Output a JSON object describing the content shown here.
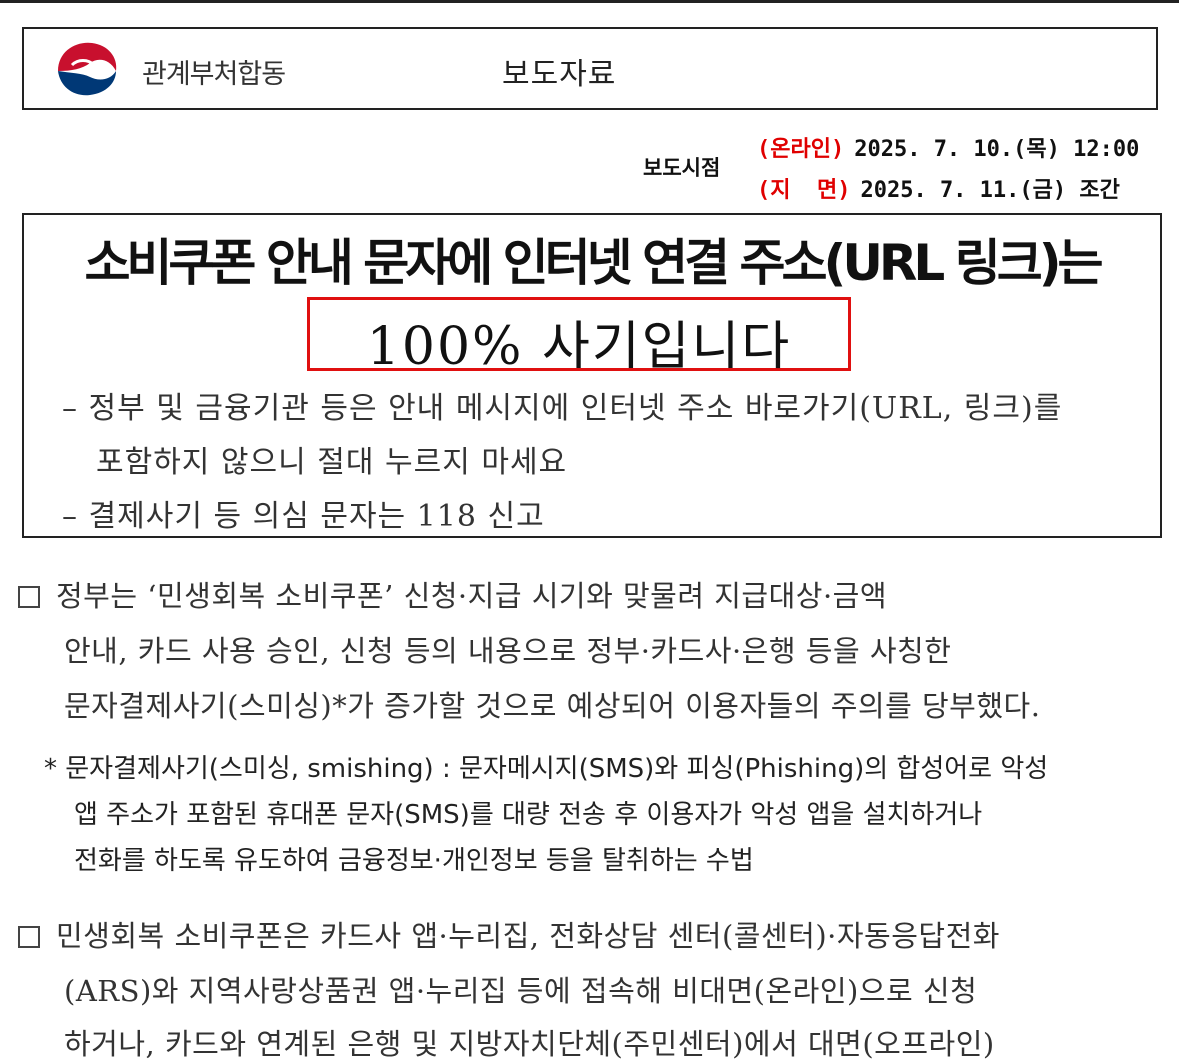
{
  "header": {
    "department": "관계부처합동",
    "doc_type": "보도자료",
    "emblem_icon": "taegeuk-emblem-icon"
  },
  "release": {
    "label": "보도시점",
    "online_kind": "(온라인)",
    "online_date": "2025. 7. 10.(목) 12:00",
    "print_kind": "(지  면)",
    "print_date": "2025. 7. 11.(금) 조간"
  },
  "headline": {
    "line1": "소비쿠폰 안내 문자에 인터넷 연결 주소(URL 링크)는",
    "line2": "100% 사기입니다",
    "sub1a": "– 정부 및 금융기관 등은 안내 메시지에 인터넷 주소 바로가기(URL, 링크)를",
    "sub1b": "포함하지 않으니 절대 누르지 마세요",
    "sub2": "– 결제사기 등 의심 문자는 118 신고"
  },
  "body": {
    "p1": [
      "정부는 ‘민생회복 소비쿠폰’ 신청·지급 시기와 맞물려 지급대상·금액",
      "안내, 카드 사용 승인, 신청 등의 내용으로 정부·카드사·은행 등을 사칭한",
      "문자결제사기(스미싱)*가 증가할 것으로 예상되어 이용자들의 주의를 당부했다."
    ],
    "note": [
      "* 문자결제사기(스미싱, smishing) : 문자메시지(SMS)와 피싱(Phishing)의 합성어로 악성",
      "앱 주소가 포함된 휴대폰 문자(SMS)를 대량 전송 후 이용자가 악성 앱을 설치하거나",
      "전화를 하도록 유도하여 금융정보·개인정보 등을 탈취하는 수법"
    ],
    "p2": [
      "민생회복 소비쿠폰은 카드사 앱·누리집, 전화상담 센터(콜센터)·자동응답전화",
      "(ARS)와 지역사랑상품권 앱·누리집 등에 접속해 비대면(온라인)으로 신청",
      "하거나, 카드와 연계된 은행 및 지방자치단체(주민센터)에서 대면(오프라인)"
    ]
  },
  "colors": {
    "accent_red": "#e01010",
    "emblem_red": "#c8102e",
    "emblem_blue": "#003876"
  }
}
